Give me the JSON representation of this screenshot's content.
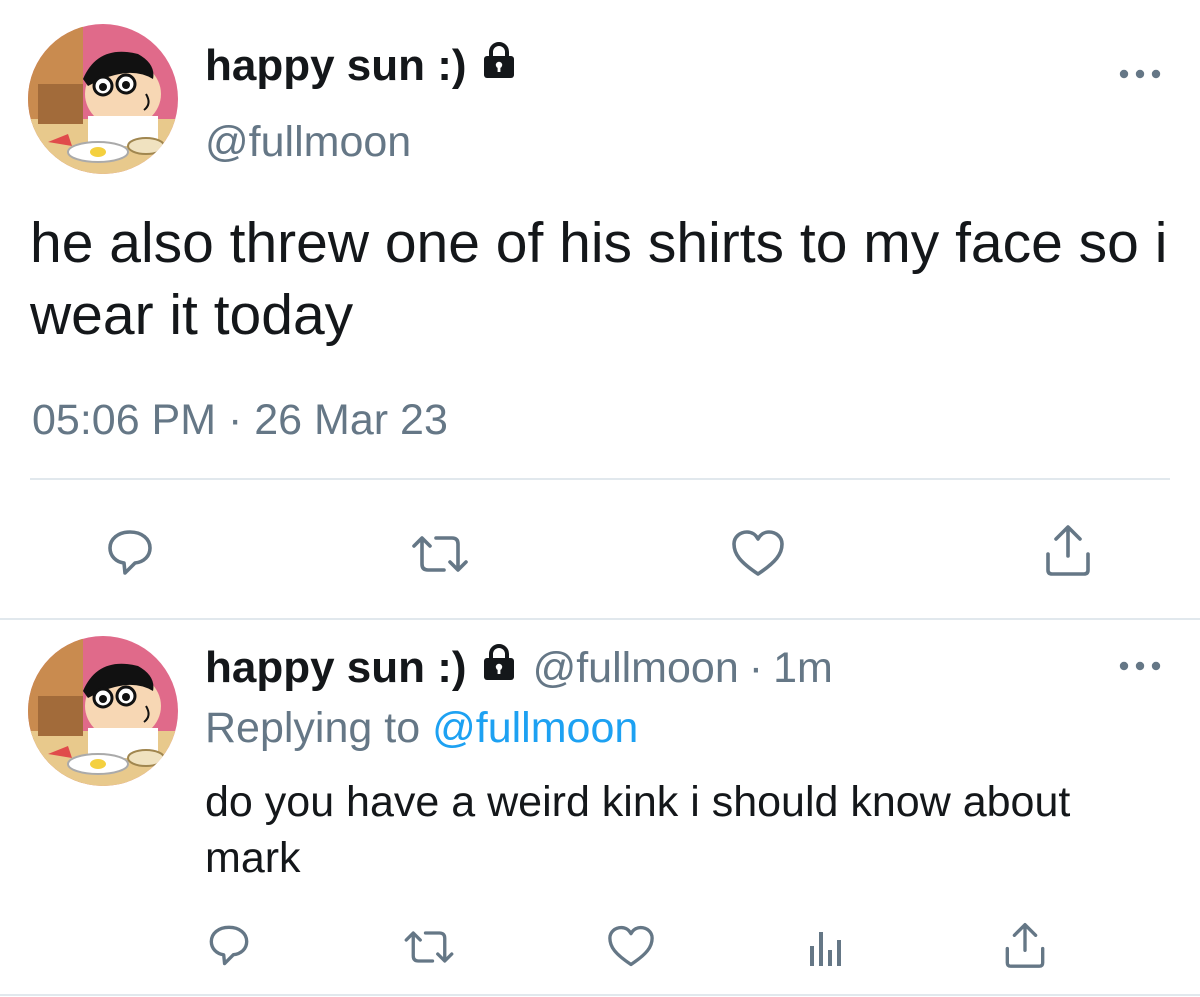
{
  "tweet": {
    "author": {
      "name": "happy sun :)",
      "handle": "@fullmoon",
      "protected_icon": "lock-icon",
      "avatar": "avatar-image"
    },
    "text": "he also threw one of his shirts to my face so i wear it today",
    "timestamp": "05:06 PM · 26 Mar 23",
    "actions": [
      "reply-icon",
      "retweet-icon",
      "like-icon",
      "share-icon"
    ],
    "more_icon": "more-icon"
  },
  "reply": {
    "author": {
      "name": "happy sun :)",
      "handle": "@fullmoon",
      "protected_icon": "lock-icon",
      "avatar": "avatar-image"
    },
    "separator": "·",
    "time": "1m",
    "replying_prefix": "Replying to",
    "replying_to": "@fullmoon",
    "text": "do you have a weird kink i should know about mark",
    "actions": [
      "reply-icon",
      "retweet-icon",
      "like-icon",
      "analytics-icon",
      "share-icon"
    ],
    "more_icon": "more-icon"
  },
  "colors": {
    "text": "#14171a",
    "secondary": "#657786",
    "link": "#1da1f2",
    "divider": "#e1e8ed",
    "icon": "#657786"
  }
}
